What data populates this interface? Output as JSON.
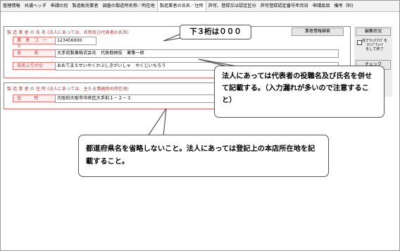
{
  "tabs": [
    {
      "label": "管理情報"
    },
    {
      "label": "共通ヘッダ"
    },
    {
      "label": "申請の別"
    },
    {
      "label": "製造販売業者"
    },
    {
      "label": "調査の製造所名称／所在地"
    },
    {
      "label": "製造業者の氏名／住所",
      "active": true
    },
    {
      "label": "許可、登録又は認定区分"
    },
    {
      "label": "許可登録認定番号年月日"
    },
    {
      "label": "申請品目"
    },
    {
      "label": "備考（料)"
    }
  ],
  "name_section": {
    "title": "製 造 業 者 の 氏 名 (法人にあっては、名称及び代表者の氏名)",
    "search_button": "業者情報検索",
    "code_label": "業者コード",
    "code_value": "123456000",
    "name_label": "氏　名",
    "name_value": "大手前製薬株式会社　代表取締役　薬事一郎",
    "kana_label": "氏名ふりがな",
    "kana_value": "おおてまえせいやくかぶしきがいしゃ　やくじいちろう"
  },
  "address_section": {
    "title": "製 造 業 者 の 住 所 (法人にあっては、主たる事務所の所在地)",
    "address_label": "住　所",
    "address_value": "大阪府大阪市中央区大手前１－２－３"
  },
  "side_panel": {
    "status_button": "編集状況",
    "checkbox_label": "完了ﾁｪｯｸﾌﾗｸﾞを\nｽﾃｯﾌﾟﾁｪｯｸ\nをして終了",
    "check_button": "チェック"
  },
  "notes": {
    "code_note": "下３桁は０００",
    "name_note": "法人にあっては代表者の役職名及び氏名を併せて記載する。（入力漏れが多いので注意すること）",
    "address_note": "都道府県名を省略しないこと。法人にあっては登記上の本店所在地を記載すること。"
  },
  "colors": {
    "section_border": "#d06a6a",
    "label_text": "#b63a3a",
    "label_bg": "#fff0f0"
  }
}
